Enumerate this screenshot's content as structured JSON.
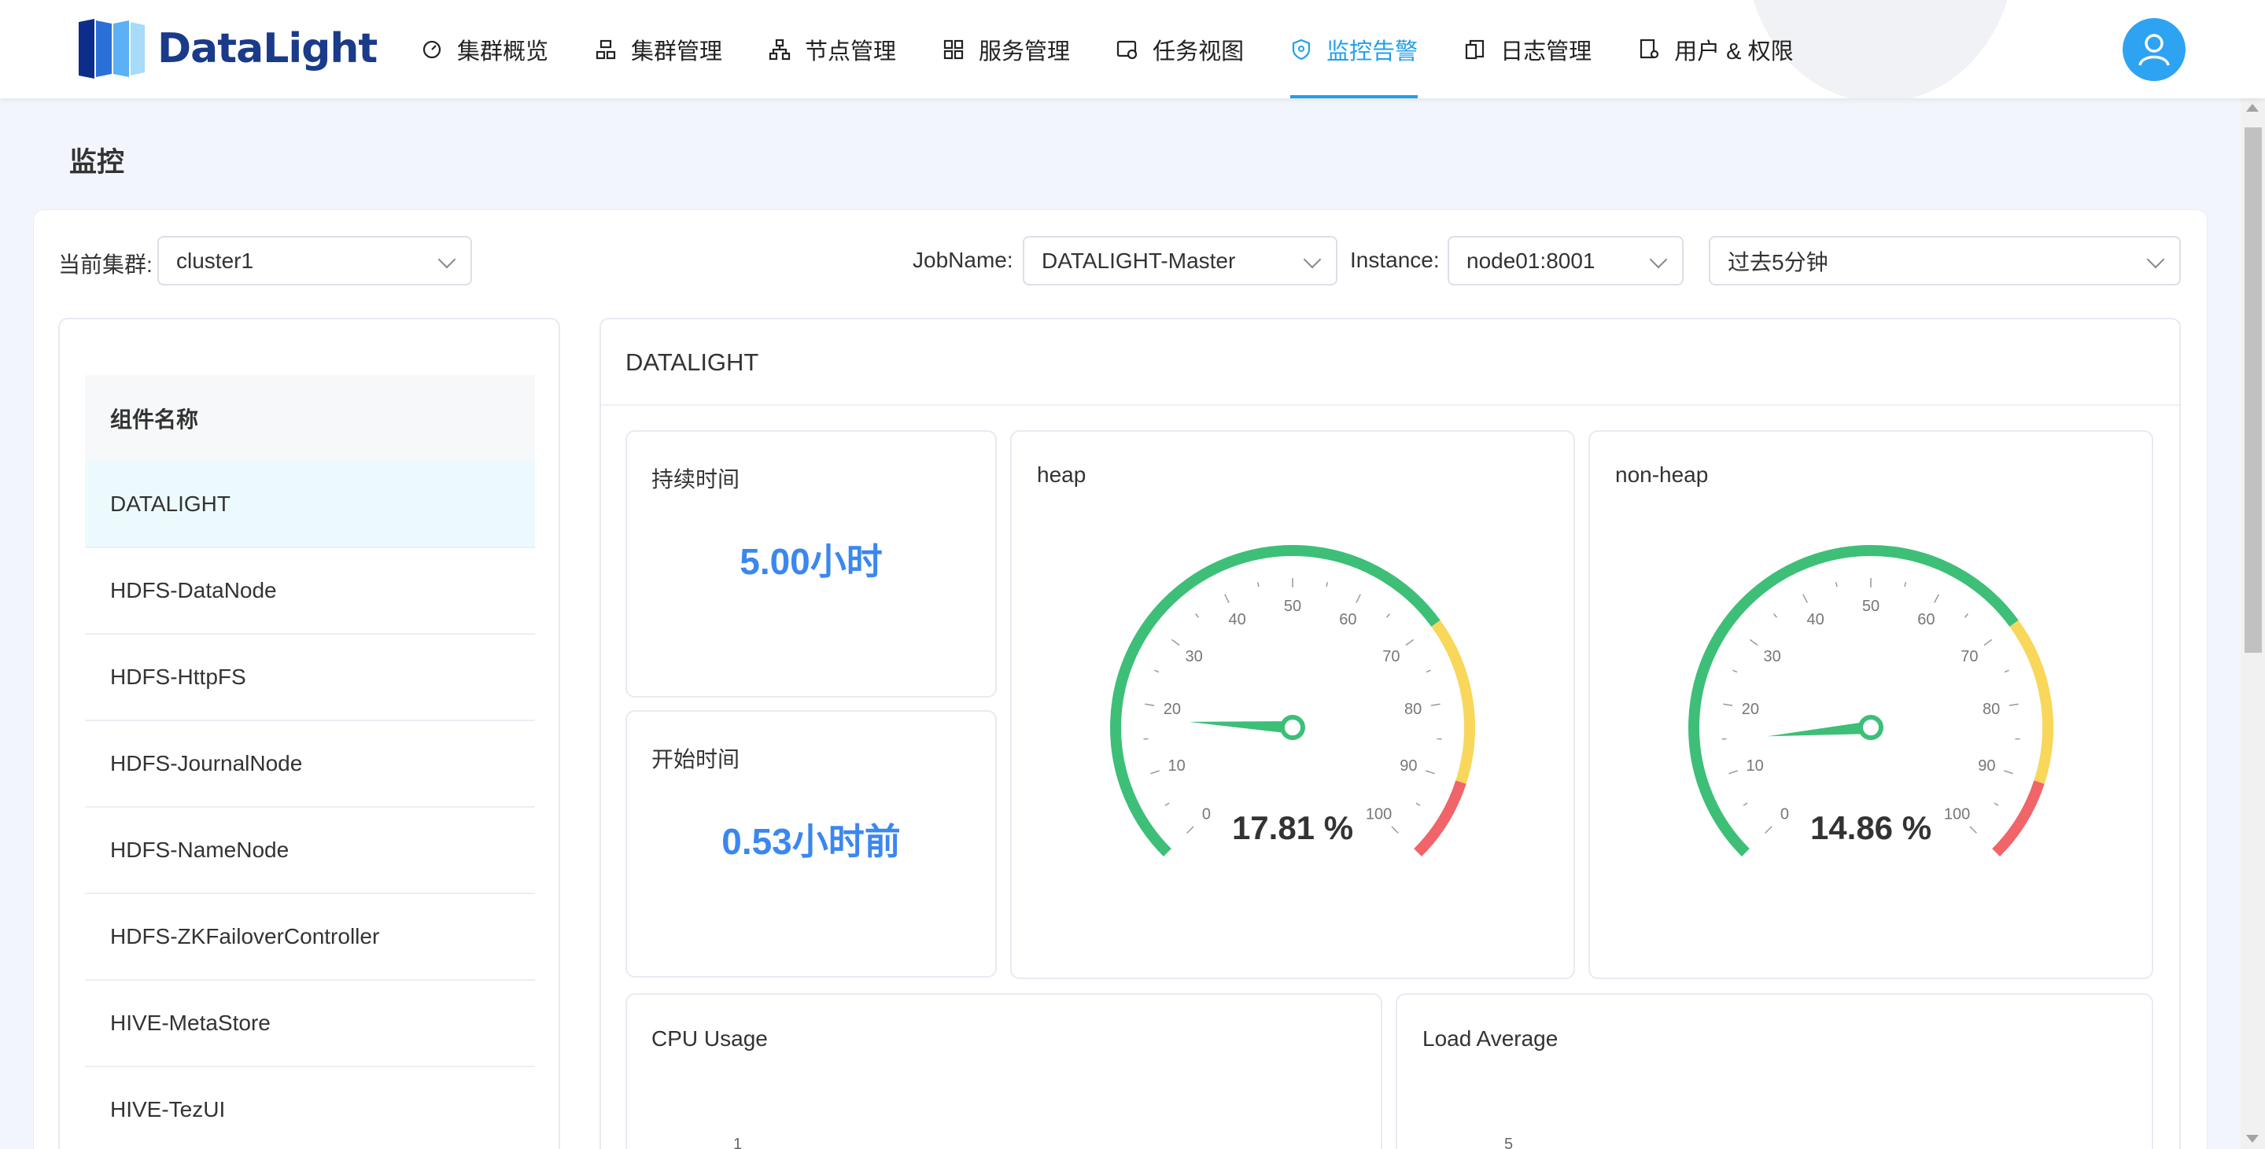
{
  "header": {
    "logo_text": "DataLight",
    "nav": [
      {
        "label": "集群概览",
        "icon": "dashboard-icon"
      },
      {
        "label": "集群管理",
        "icon": "cluster-icon"
      },
      {
        "label": "节点管理",
        "icon": "node-tree-icon"
      },
      {
        "label": "服务管理",
        "icon": "grid-icon"
      },
      {
        "label": "任务视图",
        "icon": "task-icon"
      },
      {
        "label": "监控告警",
        "icon": "shield-icon",
        "active": true
      },
      {
        "label": "日志管理",
        "icon": "log-icon"
      },
      {
        "label": "用户 & 权限",
        "icon": "user-permission-icon"
      }
    ],
    "accent": "#22a0e8"
  },
  "page": {
    "title": "监控"
  },
  "filters": {
    "cluster_label": "当前集群:",
    "cluster_value": "cluster1",
    "job_label": "JobName:",
    "job_value": "DATALIGHT-Master",
    "instance_label": "Instance:",
    "instance_value": "node01:8001",
    "time_value": "过去5分钟"
  },
  "components": {
    "header": "组件名称",
    "items": [
      "DATALIGHT",
      "HDFS-DataNode",
      "HDFS-HttpFS",
      "HDFS-JournalNode",
      "HDFS-NameNode",
      "HDFS-ZKFailoverController",
      "HIVE-MetaStore",
      "HIVE-TezUI"
    ],
    "selected": "DATALIGHT"
  },
  "dashboard": {
    "title": "DATALIGHT",
    "duration": {
      "title": "持续时间",
      "value": "5.00",
      "unit": "小时"
    },
    "start": {
      "title": "开始时间",
      "value": "0.53",
      "unit": "小时前"
    },
    "heap": {
      "title": "heap",
      "value": 17.81,
      "display": "17.81 %"
    },
    "non_heap": {
      "title": "non-heap",
      "value": 14.86,
      "display": "14.86 %"
    },
    "gauge_ticks": [
      "0",
      "10",
      "20",
      "30",
      "40",
      "50",
      "60",
      "70",
      "80",
      "90",
      "100"
    ],
    "gauge_colors": {
      "ok": "#3dbf78",
      "warn": "#f8d75a",
      "danger": "#f0646a"
    },
    "cpu": {
      "title": "CPU Usage",
      "axis_top": "1"
    },
    "load": {
      "title": "Load Average",
      "axis_top": "5"
    }
  }
}
